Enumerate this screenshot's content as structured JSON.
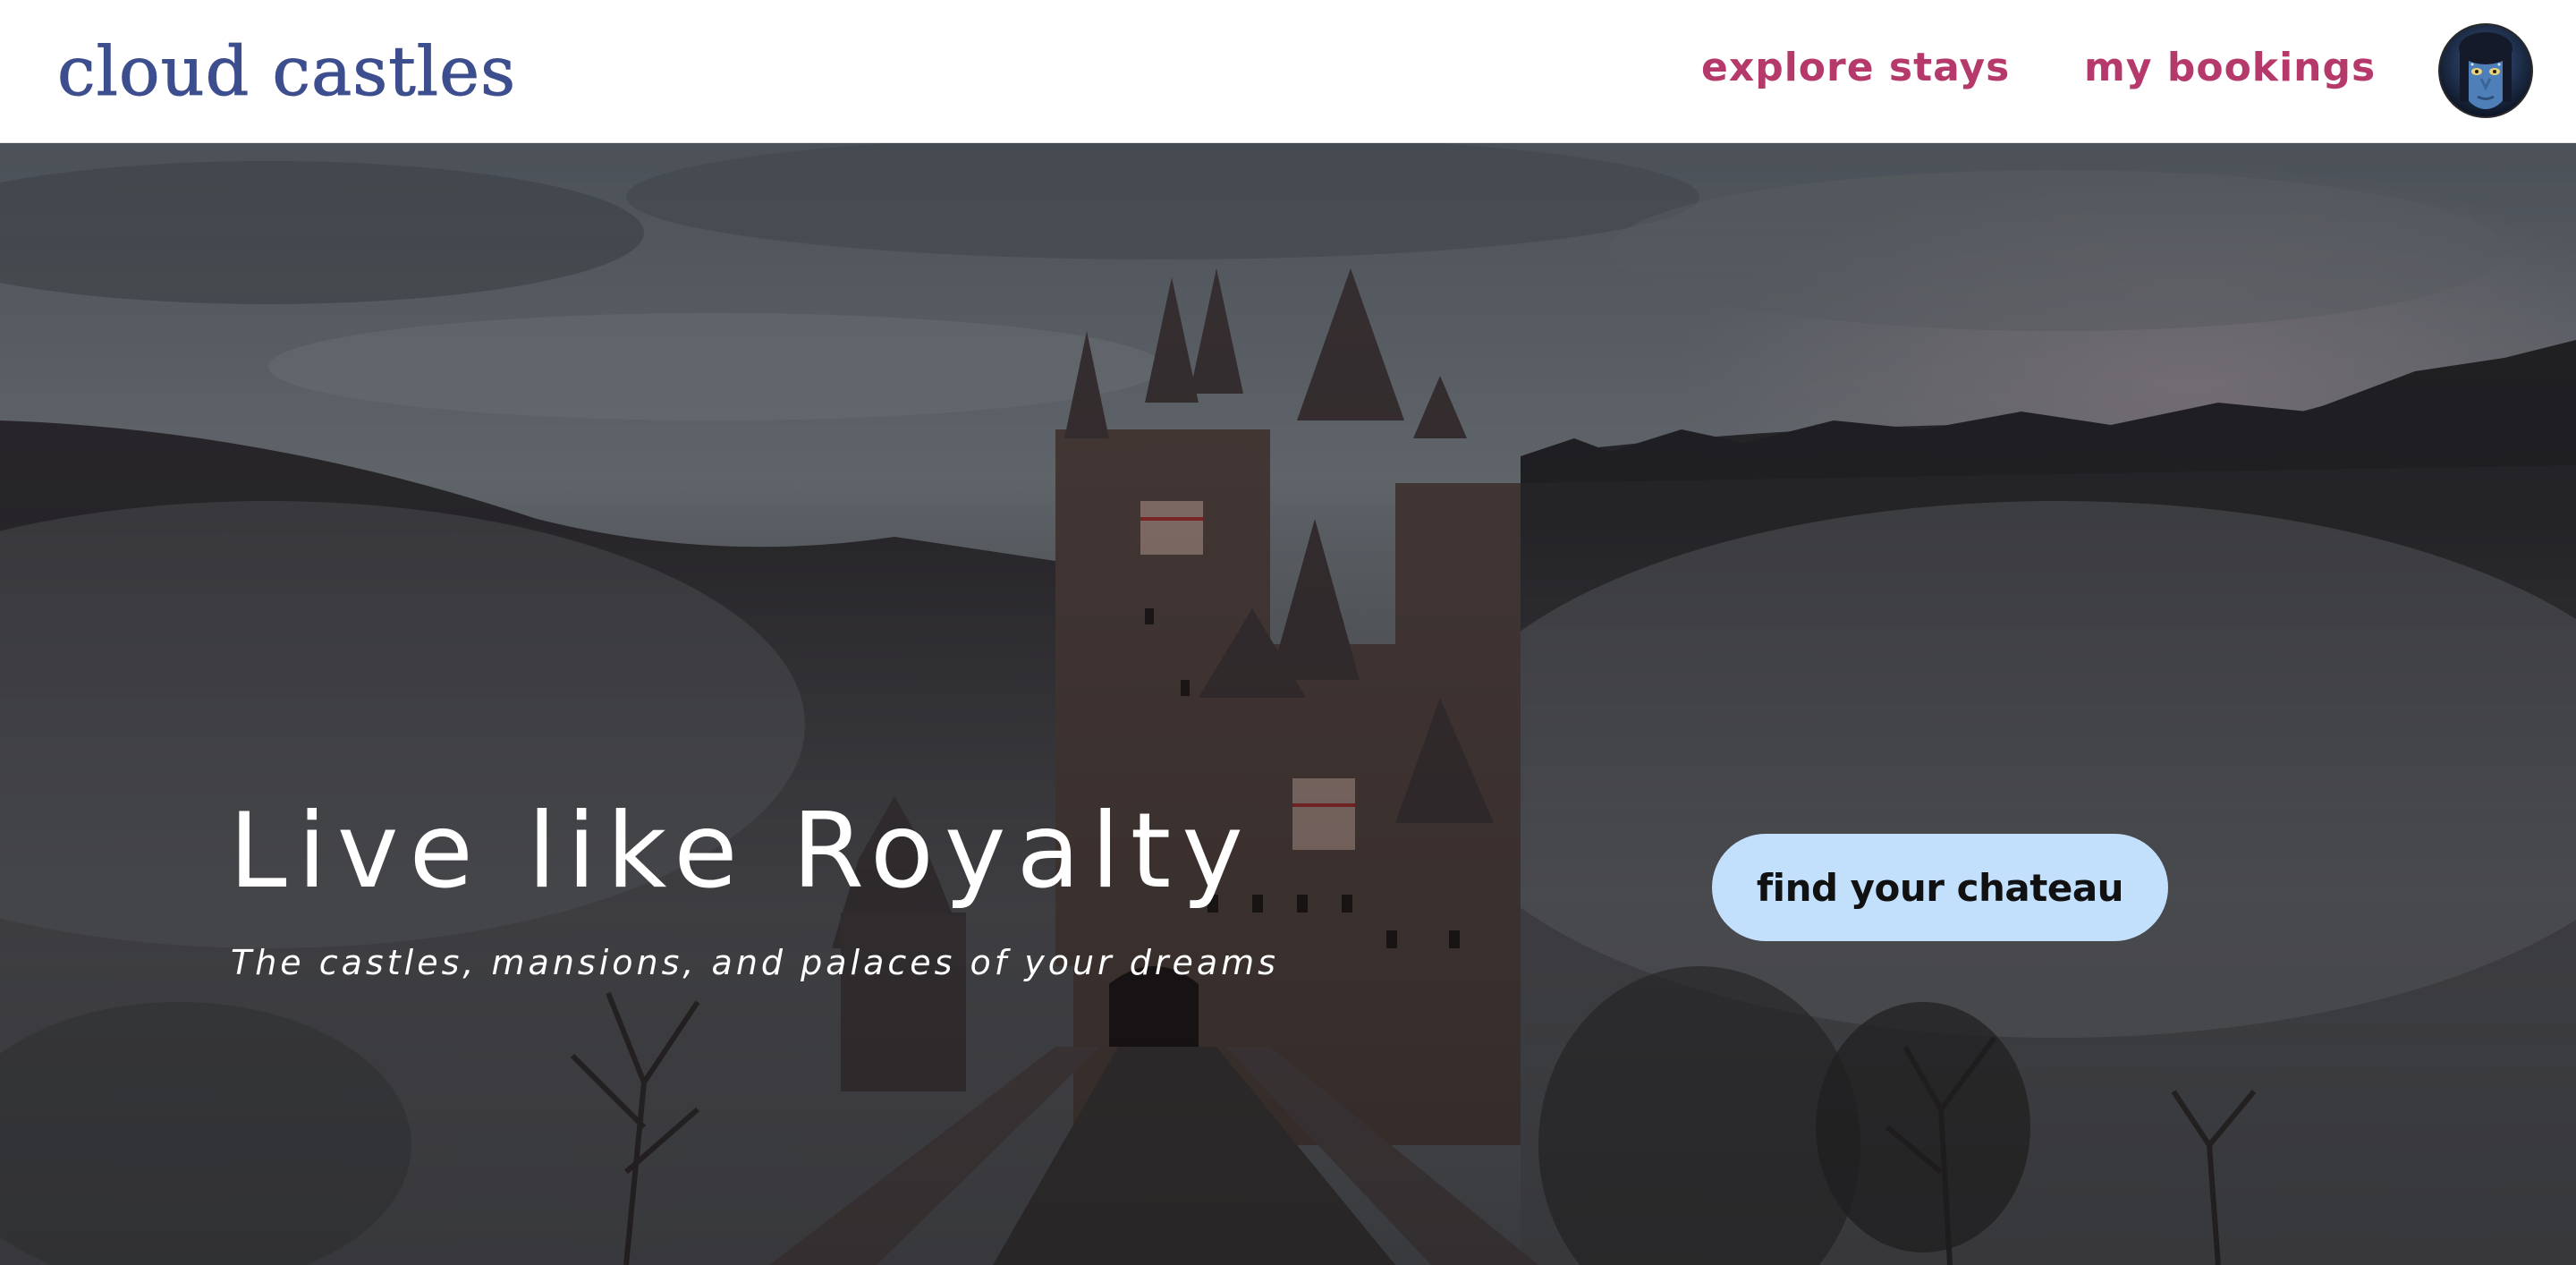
{
  "brand": {
    "name": "cloud castles",
    "color": "#3d4e8e"
  },
  "nav": {
    "links": [
      {
        "label": "explore stays"
      },
      {
        "label": "my bookings"
      }
    ],
    "link_color": "#b5396a",
    "avatar_icon": "user-avatar-icon"
  },
  "hero": {
    "title": "Live like Royalty",
    "subtitle": "The castles, mansions, and palaces of your dreams",
    "cta_label": "find your chateau",
    "cta_color": "#c2dffb",
    "background_icon": "misty-castle-photo"
  }
}
